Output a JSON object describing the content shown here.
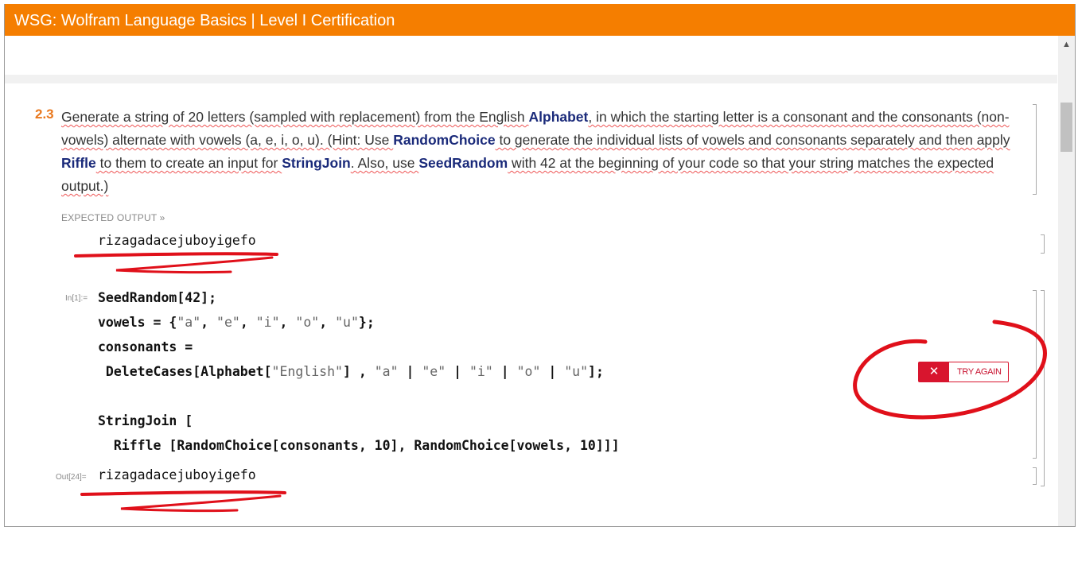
{
  "window": {
    "title": "WSG: Wolfram Language Basics | Level I Certification"
  },
  "question": {
    "number": "2.3",
    "text": [
      "Generate a string of 20 letters (sampled with replacement) from the English ",
      "Alphabet",
      ", in which the starting letter is a consonant and the consonants (non-vowels) alternate with vowels (a, e, i, o, u). (Hint: Use ",
      "RandomChoice",
      " to generate the individual lists of vowels and consonants separately and then apply ",
      "Riffle",
      " to them to create an input for ",
      "StringJoin",
      ". Also, use ",
      "SeedRandom",
      " with 42 at the beginning of your code so that your string matches the expected output.)"
    ]
  },
  "expected": {
    "label": "EXPECTED OUTPUT »",
    "value": "rizagadacejuboyigefo"
  },
  "input": {
    "label": "In[1]:=",
    "lines": [
      "SeedRandom[42];",
      "vowels = {",
      "consonants =",
      " DeleteCases[Alphabet[",
      "StringJoin [",
      "  Riffle [RandomChoice[consonants, 10], RandomChoice[vowels, 10]]]"
    ],
    "vowels_items": [
      "\"a\"",
      "\"e\"",
      "\"i\"",
      "\"o\"",
      "\"u\""
    ],
    "english_str": "\"English\"",
    "delete_tail": "] , ",
    "pattern": [
      "\"a\"",
      "\"e\"",
      "\"i\"",
      "\"o\"",
      "\"u\""
    ],
    "end": "];"
  },
  "output": {
    "label": "Out[24]=",
    "value": "rizagadacejuboyigefo"
  },
  "try_again": {
    "icon": "close-icon",
    "label": "TRY AGAIN",
    "color": "#d8152e"
  },
  "colors": {
    "titlebar": "#f57e00",
    "keyword": "#1a2a7a",
    "annotation": "#e0101a"
  }
}
